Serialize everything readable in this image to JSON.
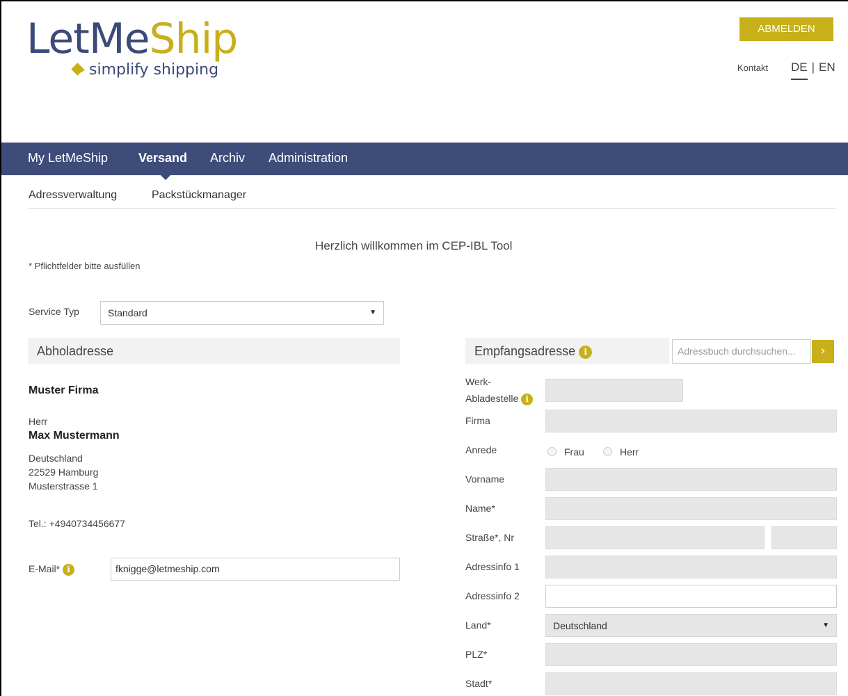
{
  "header": {
    "logo_main_a": "LetMe",
    "logo_main_b": "Ship",
    "logo_sub": "simplify shipping",
    "logout_label": "ABMELDEN",
    "contact_label": "Kontakt",
    "lang_de": "DE",
    "lang_sep": "|",
    "lang_en": "EN"
  },
  "nav": {
    "items": [
      "My LetMeShip",
      "Versand",
      "Archiv",
      "Administration"
    ],
    "active": "Versand"
  },
  "subnav": {
    "items": [
      "Adressverwaltung",
      "Packstückmanager"
    ]
  },
  "welcome": "Herzlich willkommen im CEP-IBL Tool",
  "required_note": "* Pflichtfelder bitte ausfüllen",
  "service": {
    "label": "Service Typ",
    "value": "Standard"
  },
  "pickup": {
    "title": "Abholadresse",
    "company": "Muster Firma",
    "salutation": "Herr",
    "name": "Max Mustermann",
    "country": "Deutschland",
    "city": "22529 Hamburg",
    "street": "Musterstrasse 1",
    "phone": "Tel.: +4940734456677",
    "email_label": "E-Mail*",
    "email_value": "fknigge@letmeship.com"
  },
  "recipient": {
    "title": "Empfangsadresse",
    "search_placeholder": "Adressbuch durchsuchen...",
    "fields": {
      "werk_1": "Werk-",
      "werk_2": "Abladestelle",
      "firma": "Firma",
      "anrede": "Anrede",
      "frau": "Frau",
      "herr": "Herr",
      "vorname": "Vorname",
      "name": "Name*",
      "strasse": "Straße*, Nr",
      "adressinfo1": "Adressinfo 1",
      "adressinfo2": "Adressinfo 2",
      "land": "Land*",
      "land_value": "Deutschland",
      "plz": "PLZ*",
      "stadt": "Stadt*"
    }
  },
  "colors": {
    "brand_blue": "#3e4c7a",
    "brand_gold": "#c7b01a"
  },
  "icons": [
    "info-icon",
    "chevron-right-icon",
    "caret-down-icon",
    "diamond-arrow-icon"
  ]
}
